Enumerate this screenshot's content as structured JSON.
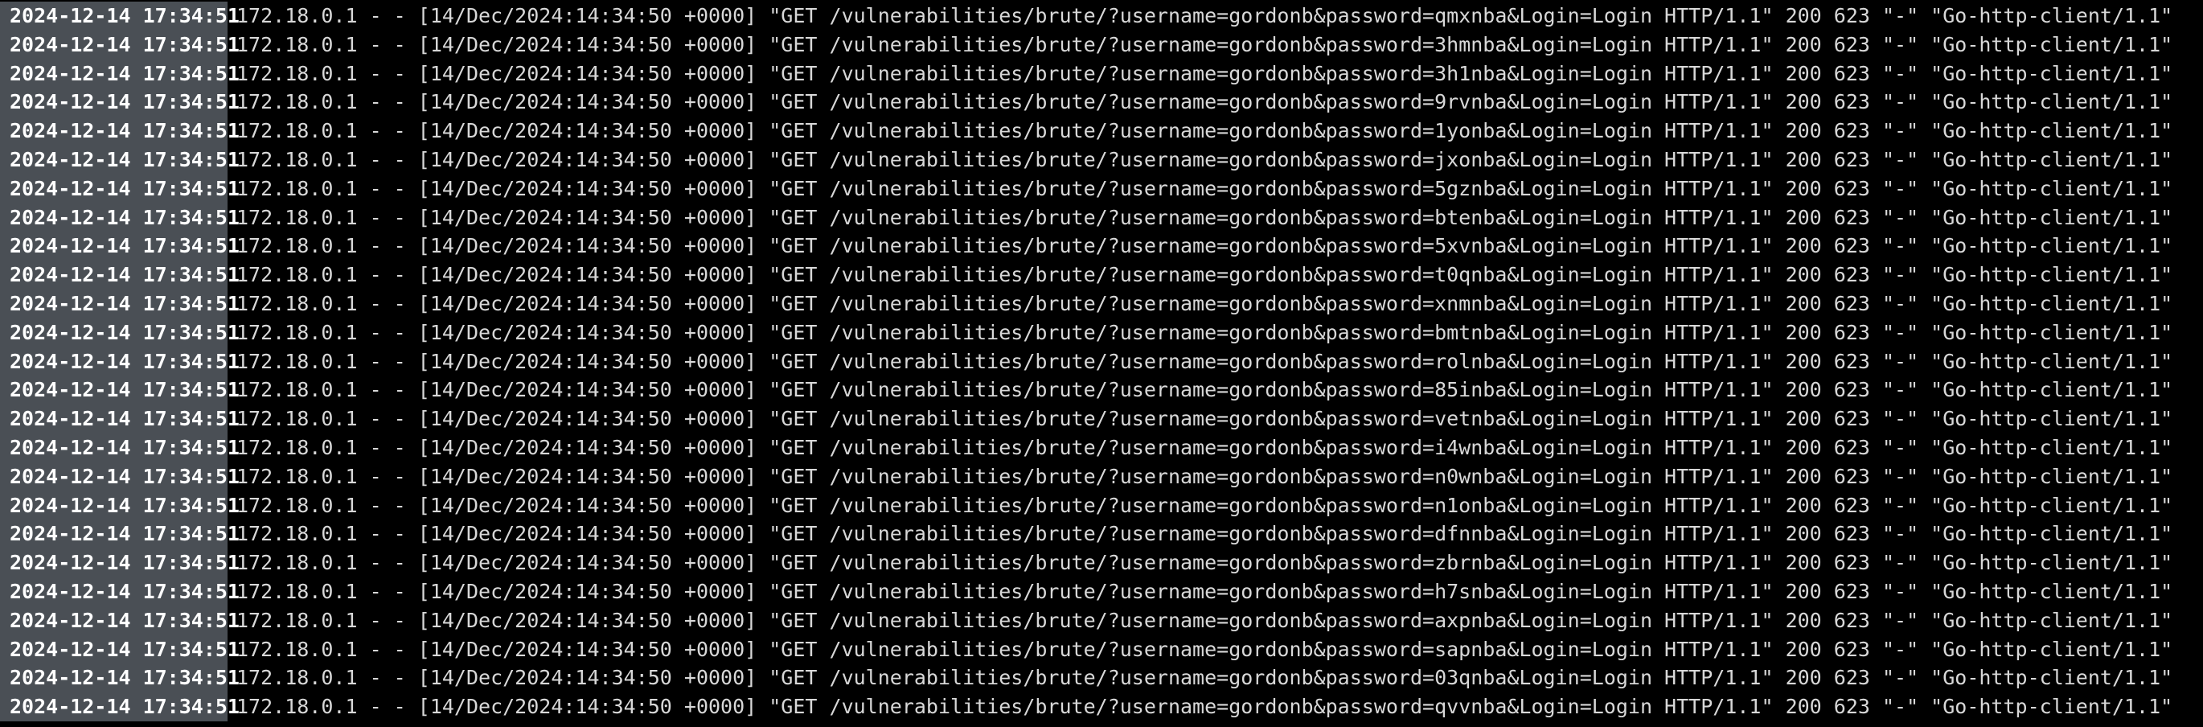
{
  "colors": {
    "background": "#000000",
    "text": "#d8d8d8",
    "timestamp_bg": "#4a4f55",
    "timestamp_text": "#ffffff"
  },
  "log": {
    "lines": [
      {
        "timestamp": "2024-12-14 17:34:51",
        "message": "172.18.0.1 - - [14/Dec/2024:14:34:50 +0000] \"GET /vulnerabilities/brute/?username=gordonb&password=qmxnba&Login=Login HTTP/1.1\" 200 623 \"-\" \"Go-http-client/1.1\""
      },
      {
        "timestamp": "2024-12-14 17:34:51",
        "message": "172.18.0.1 - - [14/Dec/2024:14:34:50 +0000] \"GET /vulnerabilities/brute/?username=gordonb&password=3hmnba&Login=Login HTTP/1.1\" 200 623 \"-\" \"Go-http-client/1.1\""
      },
      {
        "timestamp": "2024-12-14 17:34:51",
        "message": "172.18.0.1 - - [14/Dec/2024:14:34:50 +0000] \"GET /vulnerabilities/brute/?username=gordonb&password=3h1nba&Login=Login HTTP/1.1\" 200 623 \"-\" \"Go-http-client/1.1\""
      },
      {
        "timestamp": "2024-12-14 17:34:51",
        "message": "172.18.0.1 - - [14/Dec/2024:14:34:50 +0000] \"GET /vulnerabilities/brute/?username=gordonb&password=9rvnba&Login=Login HTTP/1.1\" 200 623 \"-\" \"Go-http-client/1.1\""
      },
      {
        "timestamp": "2024-12-14 17:34:51",
        "message": "172.18.0.1 - - [14/Dec/2024:14:34:50 +0000] \"GET /vulnerabilities/brute/?username=gordonb&password=1yonba&Login=Login HTTP/1.1\" 200 623 \"-\" \"Go-http-client/1.1\""
      },
      {
        "timestamp": "2024-12-14 17:34:51",
        "message": "172.18.0.1 - - [14/Dec/2024:14:34:50 +0000] \"GET /vulnerabilities/brute/?username=gordonb&password=jxonba&Login=Login HTTP/1.1\" 200 623 \"-\" \"Go-http-client/1.1\""
      },
      {
        "timestamp": "2024-12-14 17:34:51",
        "message": "172.18.0.1 - - [14/Dec/2024:14:34:50 +0000] \"GET /vulnerabilities/brute/?username=gordonb&password=5gznba&Login=Login HTTP/1.1\" 200 623 \"-\" \"Go-http-client/1.1\""
      },
      {
        "timestamp": "2024-12-14 17:34:51",
        "message": "172.18.0.1 - - [14/Dec/2024:14:34:50 +0000] \"GET /vulnerabilities/brute/?username=gordonb&password=btenba&Login=Login HTTP/1.1\" 200 623 \"-\" \"Go-http-client/1.1\""
      },
      {
        "timestamp": "2024-12-14 17:34:51",
        "message": "172.18.0.1 - - [14/Dec/2024:14:34:50 +0000] \"GET /vulnerabilities/brute/?username=gordonb&password=5xvnba&Login=Login HTTP/1.1\" 200 623 \"-\" \"Go-http-client/1.1\""
      },
      {
        "timestamp": "2024-12-14 17:34:51",
        "message": "172.18.0.1 - - [14/Dec/2024:14:34:50 +0000] \"GET /vulnerabilities/brute/?username=gordonb&password=t0qnba&Login=Login HTTP/1.1\" 200 623 \"-\" \"Go-http-client/1.1\""
      },
      {
        "timestamp": "2024-12-14 17:34:51",
        "message": "172.18.0.1 - - [14/Dec/2024:14:34:50 +0000] \"GET /vulnerabilities/brute/?username=gordonb&password=xnmnba&Login=Login HTTP/1.1\" 200 623 \"-\" \"Go-http-client/1.1\""
      },
      {
        "timestamp": "2024-12-14 17:34:51",
        "message": "172.18.0.1 - - [14/Dec/2024:14:34:50 +0000] \"GET /vulnerabilities/brute/?username=gordonb&password=bmtnba&Login=Login HTTP/1.1\" 200 623 \"-\" \"Go-http-client/1.1\""
      },
      {
        "timestamp": "2024-12-14 17:34:51",
        "message": "172.18.0.1 - - [14/Dec/2024:14:34:50 +0000] \"GET /vulnerabilities/brute/?username=gordonb&password=rolnba&Login=Login HTTP/1.1\" 200 623 \"-\" \"Go-http-client/1.1\""
      },
      {
        "timestamp": "2024-12-14 17:34:51",
        "message": "172.18.0.1 - - [14/Dec/2024:14:34:50 +0000] \"GET /vulnerabilities/brute/?username=gordonb&password=85inba&Login=Login HTTP/1.1\" 200 623 \"-\" \"Go-http-client/1.1\""
      },
      {
        "timestamp": "2024-12-14 17:34:51",
        "message": "172.18.0.1 - - [14/Dec/2024:14:34:50 +0000] \"GET /vulnerabilities/brute/?username=gordonb&password=vetnba&Login=Login HTTP/1.1\" 200 623 \"-\" \"Go-http-client/1.1\""
      },
      {
        "timestamp": "2024-12-14 17:34:51",
        "message": "172.18.0.1 - - [14/Dec/2024:14:34:50 +0000] \"GET /vulnerabilities/brute/?username=gordonb&password=i4wnba&Login=Login HTTP/1.1\" 200 623 \"-\" \"Go-http-client/1.1\""
      },
      {
        "timestamp": "2024-12-14 17:34:51",
        "message": "172.18.0.1 - - [14/Dec/2024:14:34:50 +0000] \"GET /vulnerabilities/brute/?username=gordonb&password=n0wnba&Login=Login HTTP/1.1\" 200 623 \"-\" \"Go-http-client/1.1\""
      },
      {
        "timestamp": "2024-12-14 17:34:51",
        "message": "172.18.0.1 - - [14/Dec/2024:14:34:50 +0000] \"GET /vulnerabilities/brute/?username=gordonb&password=n1onba&Login=Login HTTP/1.1\" 200 623 \"-\" \"Go-http-client/1.1\""
      },
      {
        "timestamp": "2024-12-14 17:34:51",
        "message": "172.18.0.1 - - [14/Dec/2024:14:34:50 +0000] \"GET /vulnerabilities/brute/?username=gordonb&password=dfnnba&Login=Login HTTP/1.1\" 200 623 \"-\" \"Go-http-client/1.1\""
      },
      {
        "timestamp": "2024-12-14 17:34:51",
        "message": "172.18.0.1 - - [14/Dec/2024:14:34:50 +0000] \"GET /vulnerabilities/brute/?username=gordonb&password=zbrnba&Login=Login HTTP/1.1\" 200 623 \"-\" \"Go-http-client/1.1\""
      },
      {
        "timestamp": "2024-12-14 17:34:51",
        "message": "172.18.0.1 - - [14/Dec/2024:14:34:50 +0000] \"GET /vulnerabilities/brute/?username=gordonb&password=h7snba&Login=Login HTTP/1.1\" 200 623 \"-\" \"Go-http-client/1.1\""
      },
      {
        "timestamp": "2024-12-14 17:34:51",
        "message": "172.18.0.1 - - [14/Dec/2024:14:34:50 +0000] \"GET /vulnerabilities/brute/?username=gordonb&password=axpnba&Login=Login HTTP/1.1\" 200 623 \"-\" \"Go-http-client/1.1\""
      },
      {
        "timestamp": "2024-12-14 17:34:51",
        "message": "172.18.0.1 - - [14/Dec/2024:14:34:50 +0000] \"GET /vulnerabilities/brute/?username=gordonb&password=sapnba&Login=Login HTTP/1.1\" 200 623 \"-\" \"Go-http-client/1.1\""
      },
      {
        "timestamp": "2024-12-14 17:34:51",
        "message": "172.18.0.1 - - [14/Dec/2024:14:34:50 +0000] \"GET /vulnerabilities/brute/?username=gordonb&password=03qnba&Login=Login HTTP/1.1\" 200 623 \"-\" \"Go-http-client/1.1\""
      },
      {
        "timestamp": "2024-12-14 17:34:51",
        "message": "172.18.0.1 - - [14/Dec/2024:14:34:50 +0000] \"GET /vulnerabilities/brute/?username=gordonb&password=qvvnba&Login=Login HTTP/1.1\" 200 623 \"-\" \"Go-http-client/1.1\""
      }
    ]
  }
}
